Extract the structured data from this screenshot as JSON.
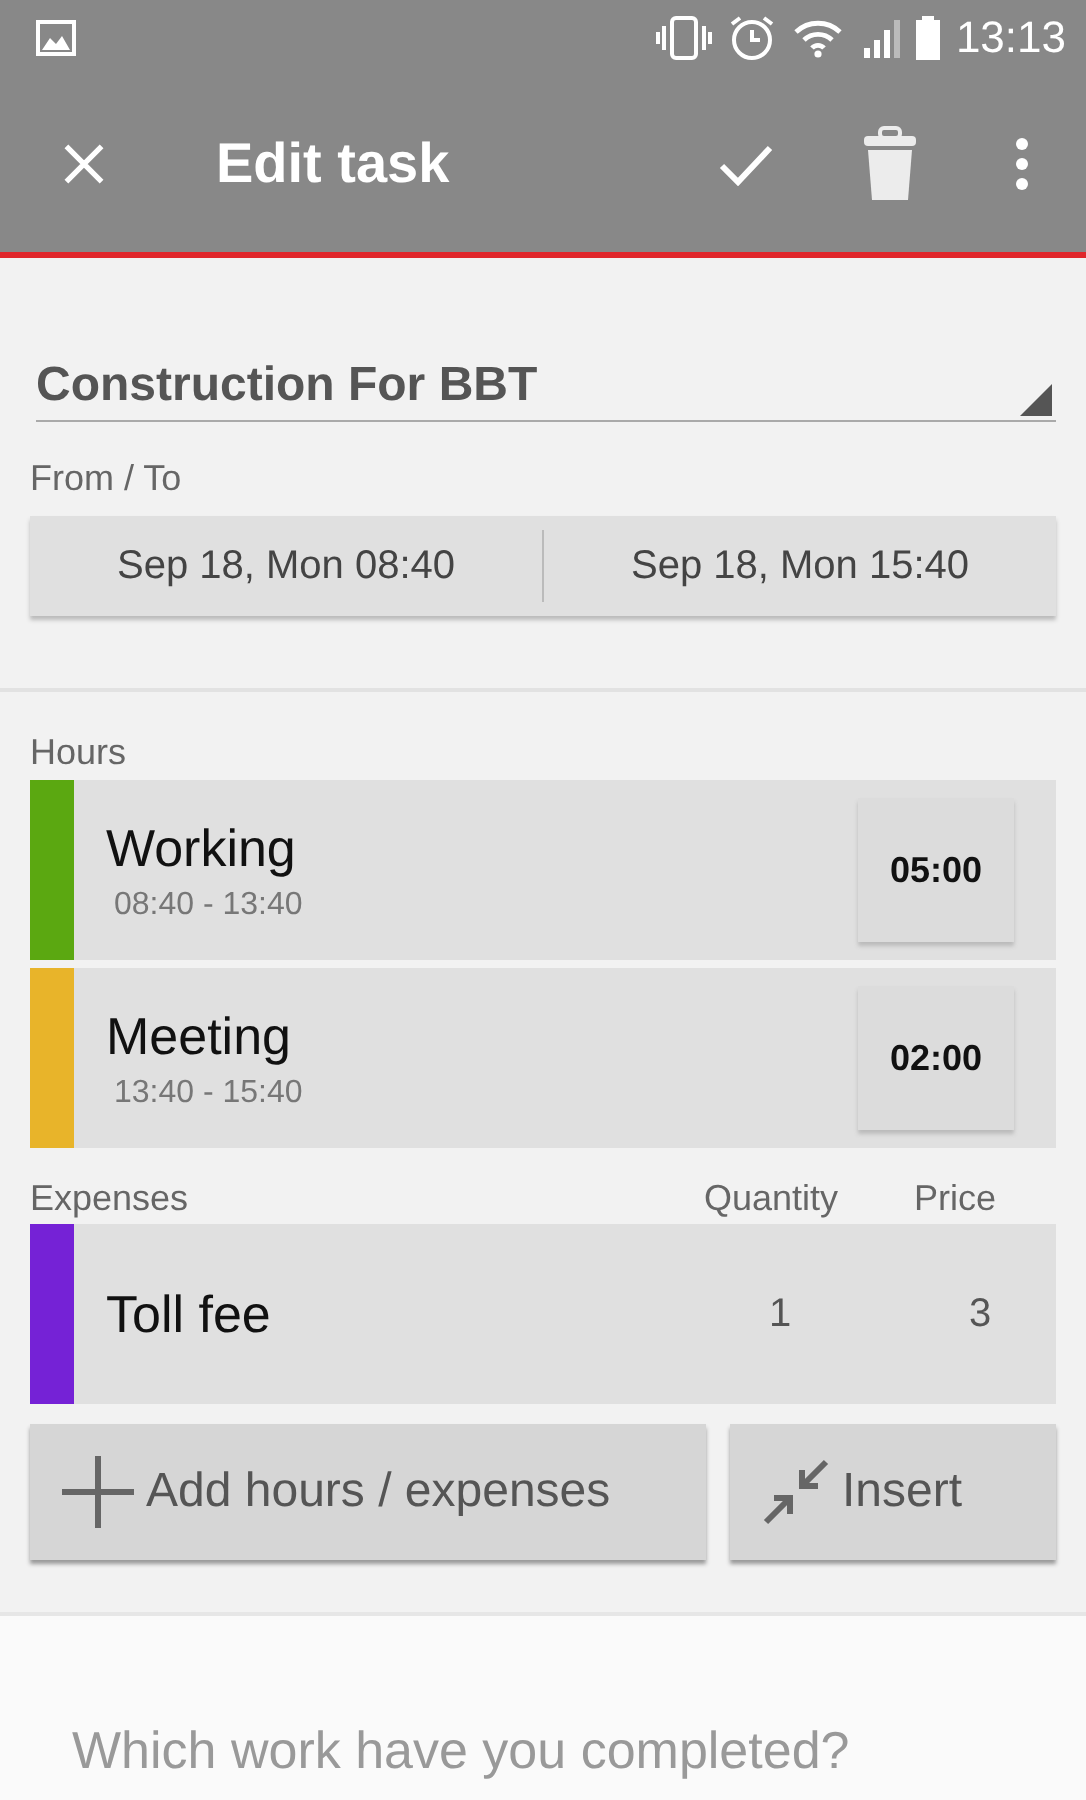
{
  "status_bar": {
    "time": "13:13"
  },
  "toolbar": {
    "title": "Edit task"
  },
  "project": {
    "value": "Construction For BBT"
  },
  "period": {
    "label": "From / To",
    "from": "Sep 18, Mon 08:40",
    "to": "Sep 18, Mon 15:40"
  },
  "hours": {
    "label": "Hours",
    "items": [
      {
        "name": "Working",
        "range": "08:40 - 13:40",
        "duration": "05:00",
        "color": "#5ba811"
      },
      {
        "name": "Meeting",
        "range": "13:40 - 15:40",
        "duration": "02:00",
        "color": "#e8b42a"
      }
    ]
  },
  "expenses": {
    "label": "Expenses",
    "columns": [
      "Quantity",
      "Price"
    ],
    "items": [
      {
        "name": "Toll fee",
        "quantity": "1",
        "price": "3",
        "color": "#7522d6"
      }
    ]
  },
  "buttons": {
    "add": "Add hours / expenses",
    "insert": "Insert"
  },
  "notes": {
    "placeholder": "Which work have you completed?"
  }
}
